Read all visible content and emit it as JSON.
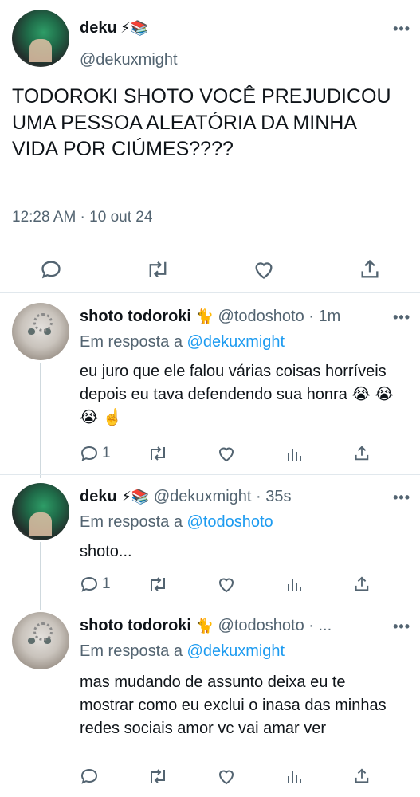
{
  "main": {
    "name": "deku",
    "name_emoji": "⚡📚",
    "handle": "@dekuxmight",
    "text": "TODOROKI SHOTO VOCÊ PREJUDICOU UMA PESSOA ALEATÓRIA DA MINHA VIDA POR CIÚMES????",
    "timestamp": "12:28 AM · 10 out 24"
  },
  "replies": [
    {
      "name": "shoto todoroki",
      "name_emoji": "🐈",
      "handle_time": "@todoshoto · 1m",
      "reply_prefix": "Em resposta a",
      "reply_to": "@dekuxmight",
      "text": "eu juro que ele falou várias coisas horríveis depois eu tava defendendo sua honra 😭 😭 😭 ☝️",
      "reply_count": "1"
    },
    {
      "name": "deku",
      "name_emoji": "⚡📚",
      "handle_time": "@dekuxmight · 35s",
      "reply_prefix": "Em resposta a",
      "reply_to": "@todoshoto",
      "text": "shoto...",
      "reply_count": "1"
    },
    {
      "name": "shoto todoroki",
      "name_emoji": "🐈",
      "handle_time": "@todoshoto · ...",
      "reply_prefix": "Em resposta a",
      "reply_to": "@dekuxmight",
      "text": "mas mudando de assunto deixa eu te mostrar como eu exclui o inasa das minhas redes sociais amor vc vai amar ver",
      "reply_count": ""
    }
  ],
  "more_glyph": "•••",
  "colors": {
    "link": "#1d9bf0",
    "secondary": "#536471",
    "divider": "#cfd9de"
  },
  "icons": [
    "reply-icon",
    "retweet-icon",
    "like-icon",
    "share-icon",
    "analytics-icon",
    "more-icon"
  ]
}
